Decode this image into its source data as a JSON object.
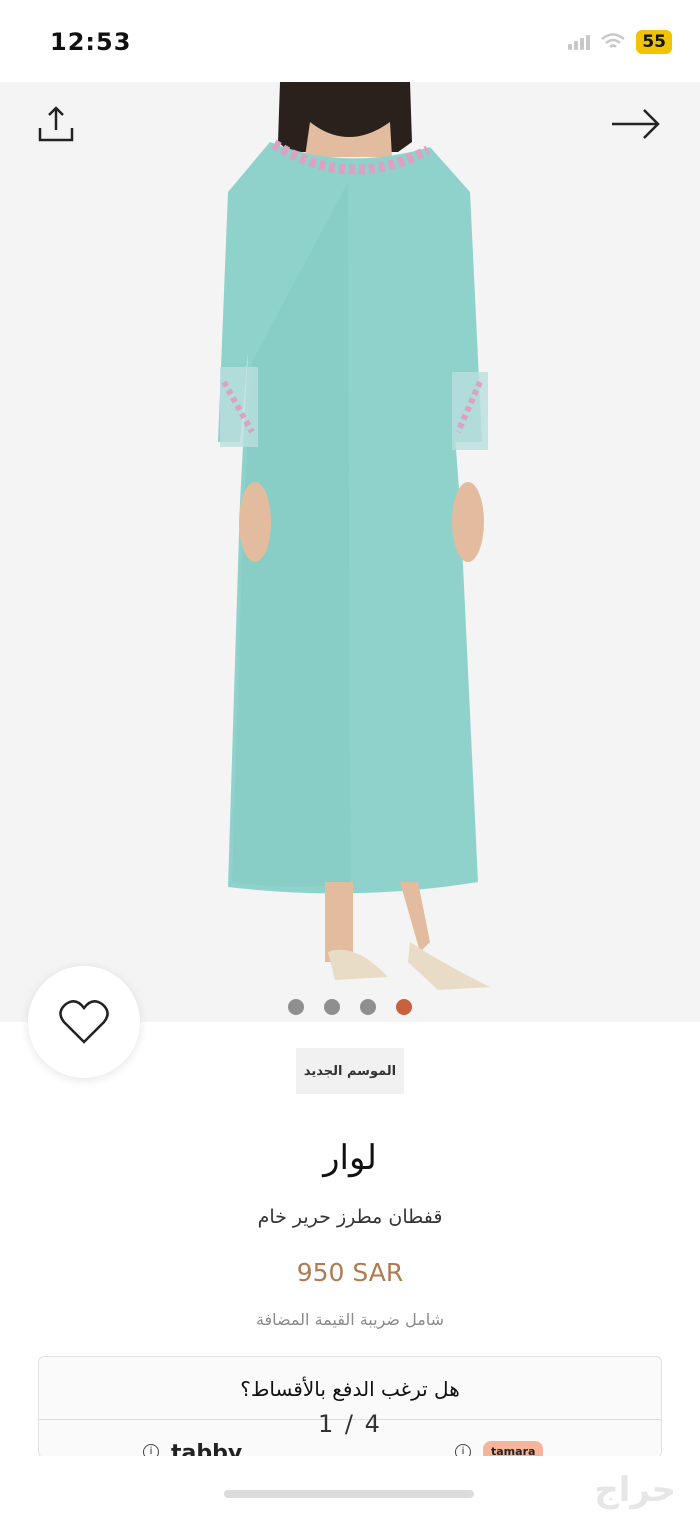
{
  "status_bar": {
    "time": "12:53",
    "battery": "55"
  },
  "gallery": {
    "share_icon": "share-icon",
    "next_icon": "arrow-right-icon",
    "dots_count": 4,
    "active_index": 3,
    "counter": "1 / 4"
  },
  "favorite": {
    "icon": "heart-icon"
  },
  "product": {
    "badge": "الموسم الجديد",
    "brand": "لوار",
    "name": "قفطان مطرز حرير خام",
    "price": "950 SAR",
    "vat_note": "شامل ضريبة القيمة المضافة"
  },
  "installments": {
    "question": "هل ترغب الدفع بالأقساط؟",
    "providers": [
      "tabby",
      "tamara"
    ]
  },
  "watermark": "حراج",
  "colors": {
    "price": "#b07a53",
    "active_dot": "#c8613e",
    "dress": "#8fd2cc"
  }
}
